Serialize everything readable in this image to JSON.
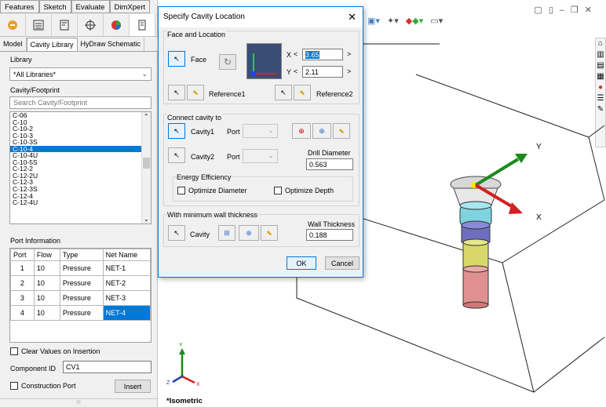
{
  "cmd_tabs": [
    "Features",
    "Sketch",
    "Evaluate",
    "DimXpert"
  ],
  "sub_tabs": [
    "Model",
    "Cavity Library",
    "HyDraw Schematic"
  ],
  "library": {
    "label": "Library",
    "value": "*All Libraries*"
  },
  "cavity": {
    "label": "Cavity/Footprint",
    "search_placeholder": "Search Cavity/Footprint",
    "items": [
      "C-06",
      "C-10",
      "C-10-2",
      "C-10-3",
      "C-10-3S",
      "C-10-4",
      "C-10-4U",
      "C-10-5S",
      "C-12-2",
      "C-12-2U",
      "C-12-3",
      "C-12-3S",
      "C-12-4",
      "C-12-4U"
    ],
    "selected_index": 5
  },
  "ports": {
    "label": "Port Information",
    "headers": [
      "Port",
      "Flow",
      "Type",
      "Net Name"
    ],
    "rows": [
      [
        "1",
        "10",
        "Pressure",
        "NET-1"
      ],
      [
        "2",
        "10",
        "Pressure",
        "NET-2"
      ],
      [
        "3",
        "10",
        "Pressure",
        "NET-3"
      ],
      [
        "4",
        "10",
        "Pressure",
        "NET-4"
      ]
    ]
  },
  "clear_values_label": "Clear Values on Insertion",
  "component_id": {
    "label": "Component ID",
    "value": "CV1"
  },
  "construction_port_label": "Construction Port",
  "insert_label": "Insert",
  "dialog": {
    "title": "Specify Cavity Location",
    "face_group": "Face and Location",
    "face_label": "Face",
    "x_label": "X",
    "x_value": "3.65",
    "y_label": "Y",
    "y_value": "2.11",
    "ref1_label": "Reference1",
    "ref2_label": "Reference2",
    "connect_group": "Connect cavity to",
    "cavity1_label": "Cavity1",
    "cavity2_label": "Cavity2",
    "port_label": "Port",
    "drill_label": "Drill Diameter",
    "drill_value": "0.563",
    "energy_group": "Energy Efficiency",
    "opt_diameter_label": "Optimize Diameter",
    "opt_depth_label": "Optimize Depth",
    "wall_group": "With minimum wall thickness",
    "cavity_label": "Cavity",
    "wall_label": "Wall Thickness",
    "wall_value": "0.188",
    "ok_label": "OK",
    "cancel_label": "Cancel"
  },
  "viewport": {
    "view_label": "*Isometric",
    "axis_x": "X",
    "axis_y": "Y",
    "triad_x": "X",
    "triad_y": "Y",
    "triad_z": "Z"
  },
  "colors": {
    "accent": "#0078d7",
    "selection": "#0078d7"
  }
}
